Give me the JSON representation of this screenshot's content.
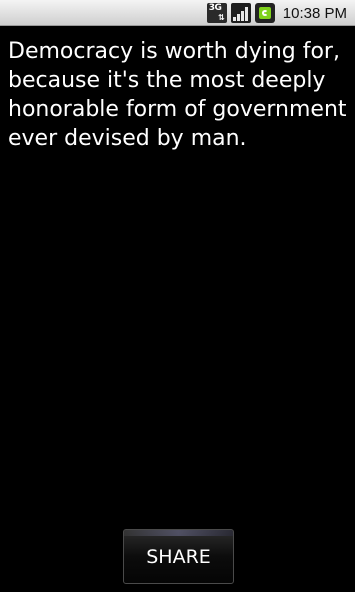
{
  "status_bar": {
    "network_label": "3G",
    "time": "10:38 PM",
    "signal_bars_filled": 4,
    "battery_color": "#7fd11b"
  },
  "quote": {
    "text": "Democracy is worth dying for, because it's the most deeply honorable form of government ever devised by man."
  },
  "actions": {
    "share_label": "SHARE"
  }
}
